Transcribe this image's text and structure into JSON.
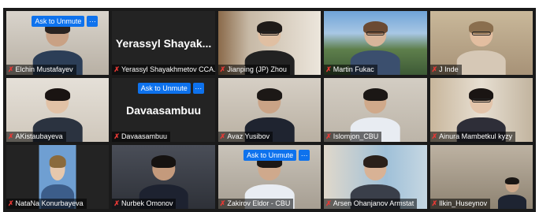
{
  "meeting": {
    "participants": [
      {
        "name": "Elchin  Mustafayev",
        "video": true,
        "muted": true,
        "show_unmute": true
      },
      {
        "name": "Yerassyl Shayakhmetov CCA...",
        "video": false,
        "muted": true,
        "big_name": "Yerassyl  Shayak..."
      },
      {
        "name": "Jianping (JP) Zhou",
        "video": true,
        "muted": true
      },
      {
        "name": "Martin Fukac",
        "video": true,
        "muted": true,
        "active_speaker": true
      },
      {
        "name": "J Inde",
        "video": true,
        "muted": true
      },
      {
        "name": "AKistaubayeva",
        "video": true,
        "muted": true
      },
      {
        "name": "Davaasambuu",
        "video": false,
        "muted": true,
        "show_unmute": true,
        "big_name": "Davaasambuu"
      },
      {
        "name": "Avaz Yusibov",
        "video": true,
        "muted": true
      },
      {
        "name": "Islomjon_CBU",
        "video": true,
        "muted": true
      },
      {
        "name": "Ainura Mambetkul kyzy",
        "video": true,
        "muted": true
      },
      {
        "name": "NataNa Konurbayeva",
        "video": true,
        "muted": true
      },
      {
        "name": "Nurbek Omonov",
        "video": true,
        "muted": true
      },
      {
        "name": "Zakirov Eldor - CBU",
        "video": true,
        "muted": true,
        "show_unmute": true
      },
      {
        "name": "Arsen Ohanjanov Armstat",
        "video": true,
        "muted": true
      },
      {
        "name": "Ilkin_Huseynov",
        "video": true,
        "muted": true
      }
    ],
    "unmute_label": "Ask to Unmute",
    "more_label": "···",
    "mute_icon": "muted-mic-icon"
  }
}
